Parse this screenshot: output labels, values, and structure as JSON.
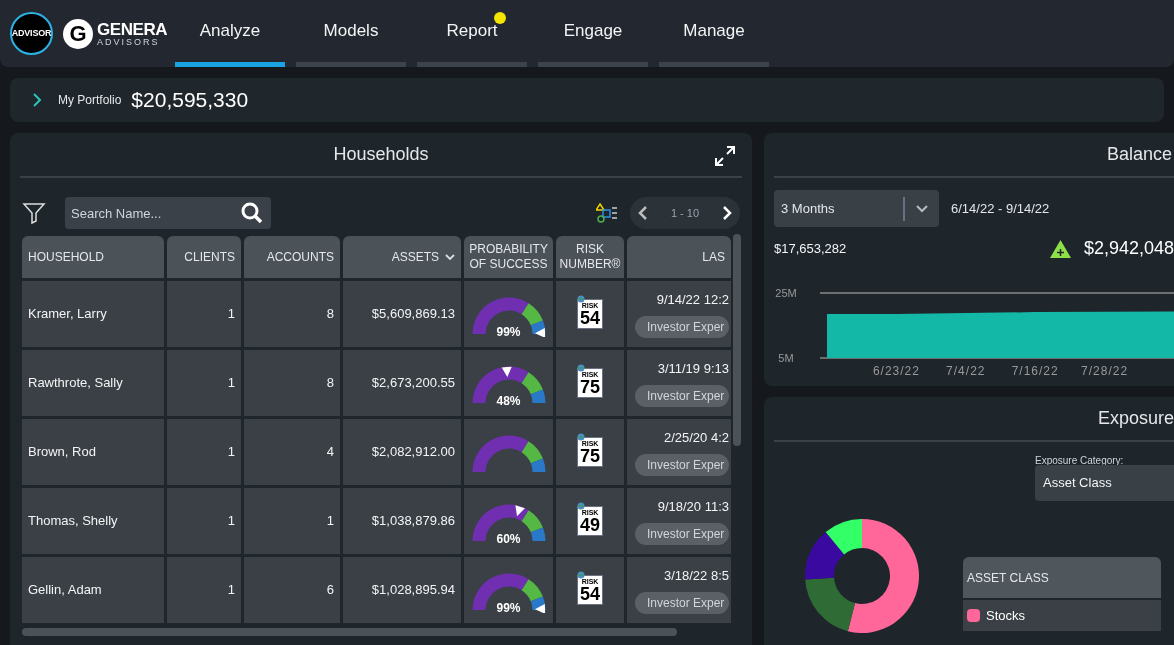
{
  "logos": {
    "badge": "ADVISOR",
    "mark": "G",
    "brand": "GENERA",
    "brand_sub": "ADVISORS"
  },
  "tabs": [
    {
      "label": "Analyze",
      "selected": true,
      "notification": false
    },
    {
      "label": "Models",
      "selected": false,
      "notification": false
    },
    {
      "label": "Report",
      "selected": false,
      "notification": true
    },
    {
      "label": "Engage",
      "selected": false,
      "notification": false
    },
    {
      "label": "Manage",
      "selected": false,
      "notification": false
    }
  ],
  "portfolio": {
    "label": "My Portfolio",
    "value": "$20,595,330"
  },
  "households": {
    "title": "Households",
    "search": {
      "placeholder": "Search Name..."
    },
    "pager": "1 - 10",
    "columns": [
      "HOUSEHOLD",
      "CLIENTS",
      "ACCOUNTS",
      "ASSETS",
      "PROBABILITY OF SUCCESS",
      "RISK NUMBER®",
      "LAS"
    ],
    "rows": [
      {
        "household": "Kramer, Larry",
        "clients": "1",
        "accounts": "8",
        "assets": "$5,609,869.13",
        "probability": "99%",
        "level": 0.99,
        "risk_label": "RISK",
        "risk": "54",
        "last": "9/14/22 12:2",
        "status": "Investor Exper"
      },
      {
        "household": "Rawthrote, Sally",
        "clients": "1",
        "accounts": "8",
        "assets": "$2,673,200.55",
        "probability": "48%",
        "level": 0.48,
        "risk_label": "RISK",
        "risk": "75",
        "last": "3/11/19 9:13",
        "status": "Investor Exper"
      },
      {
        "household": "Brown, Rod",
        "clients": "1",
        "accounts": "4",
        "assets": "$2,082,912.00",
        "risk_label": "RISK",
        "risk": "75",
        "last": "2/25/20 4:2",
        "status": "Investor Exper"
      },
      {
        "household": "Thomas, Shelly",
        "clients": "1",
        "accounts": "1",
        "assets": "$1,038,879.86",
        "probability": "60%",
        "level": 0.6,
        "risk_label": "RISK",
        "risk": "49",
        "last": "9/18/20 11:3",
        "status": "Investor Exper"
      },
      {
        "household": "Gellin, Adam",
        "clients": "1",
        "accounts": "6",
        "assets": "$1,028,895.94",
        "probability": "99%",
        "level": 0.99,
        "risk_label": "RISK",
        "risk": "54",
        "last": "3/18/22 8:5",
        "status": "Investor Exper"
      }
    ]
  },
  "balance": {
    "title": "Balance",
    "period": "3 Months",
    "range": "6/14/22 - 9/14/22",
    "start_value": "$17,653,282",
    "change": "$2,942,048",
    "chart_data": {
      "type": "area",
      "categories": [
        null,
        "6/23/22",
        "7/4/22",
        "7/16/22",
        "7/28/22",
        null
      ],
      "series": [
        {
          "color": "#14b8a6",
          "values": [
            18.2,
            18.2,
            18.5,
            18.8,
            18.9,
            19.0
          ]
        }
      ],
      "ylim": [
        5,
        25
      ],
      "yticks": [
        {
          "value": 5,
          "label": "5M"
        },
        {
          "value": 25,
          "label": "25M"
        }
      ]
    }
  },
  "exposure": {
    "title": "Exposure",
    "category_label": "Exposure Category:",
    "category": "Asset Class",
    "legend_header": "ASSET CLASS",
    "legend": [
      {
        "label": "Stocks",
        "color": "#ff6699"
      }
    ]
  }
}
